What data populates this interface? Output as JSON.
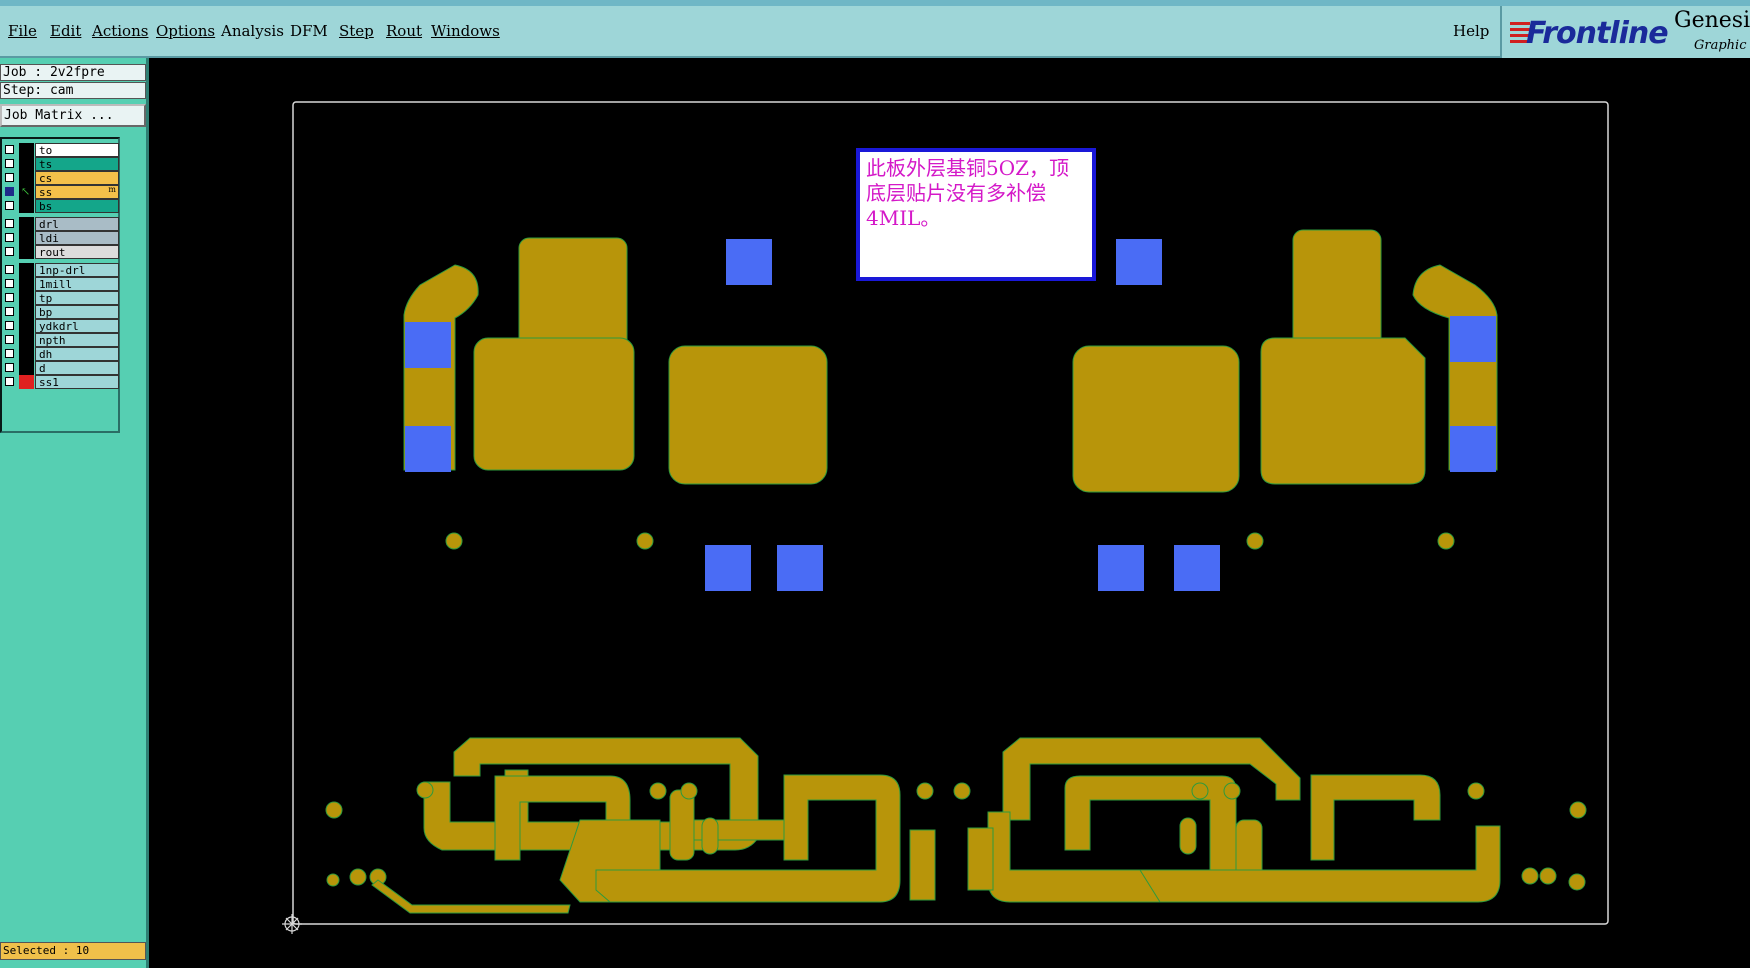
{
  "menu": {
    "items": [
      "File",
      "Edit",
      "Actions",
      "Options",
      "Analysis",
      "DFM",
      "Step",
      "Rout",
      "Windows"
    ],
    "help": "Help"
  },
  "brand": {
    "logo": "Frontline",
    "product": "Genesis",
    "tagline": "Graphic E"
  },
  "job": {
    "job_label": "Job : 2v2fpre",
    "step_label": "Step: cam",
    "matrix_button": "Job Matrix ..."
  },
  "layers": [
    {
      "name": "to",
      "color": "#ffffff",
      "checked": false
    },
    {
      "name": "ts",
      "color": "#14a68a",
      "checked": false
    },
    {
      "name": "cs",
      "color": "#f4c04a",
      "checked": false
    },
    {
      "name": "ss",
      "color": "#f4c04a",
      "checked": true,
      "active": true
    },
    {
      "name": "bs",
      "color": "#14a68a",
      "checked": false
    },
    {
      "name": "drl",
      "color": "#a9bcc6",
      "checked": false
    },
    {
      "name": "ldi",
      "color": "#a9bcc6",
      "checked": false
    },
    {
      "name": "rout",
      "color": "#dcdcdc",
      "checked": false
    },
    {
      "name": "1np-drl",
      "color": "#9ed6d8",
      "checked": false
    },
    {
      "name": "1mill",
      "color": "#9ed6d8",
      "checked": false
    },
    {
      "name": "tp",
      "color": "#9ed6d8",
      "checked": false
    },
    {
      "name": "bp",
      "color": "#9ed6d8",
      "checked": false
    },
    {
      "name": "ydkdrl",
      "color": "#9ed6d8",
      "checked": false
    },
    {
      "name": "npth",
      "color": "#9ed6d8",
      "checked": false
    },
    {
      "name": "dh",
      "color": "#9ed6d8",
      "checked": false
    },
    {
      "name": "d",
      "color": "#9ed6d8",
      "checked": false
    },
    {
      "name": "ss1",
      "color": "#9ed6d8",
      "checked": false,
      "swatch": "#e02020"
    }
  ],
  "status": {
    "selected": "Selected : 10"
  },
  "note": {
    "text": "此板外层基铜5OZ，顶底层贴片没有多补偿4MIL。"
  },
  "colors": {
    "copper": "#b8950a",
    "pad": "#4a6cf5",
    "outline": "#d8d8d8",
    "edge": "#2e9a3c"
  }
}
